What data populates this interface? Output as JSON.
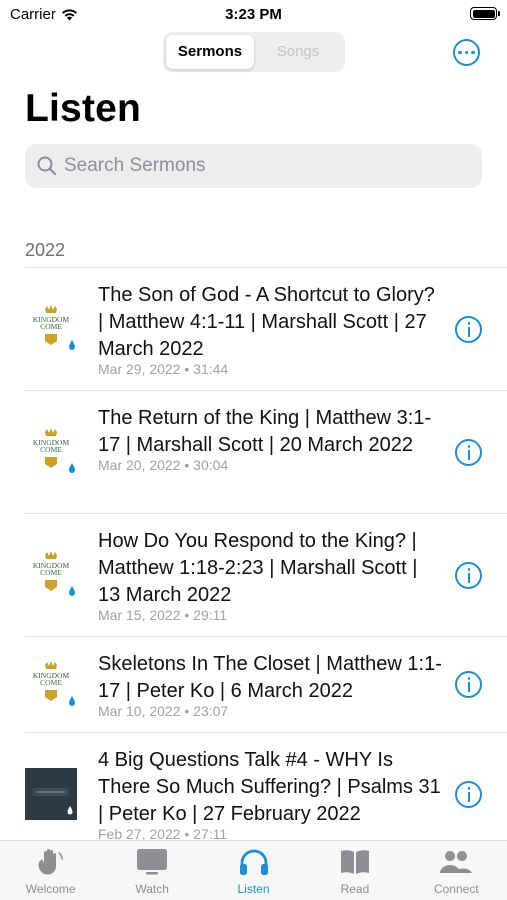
{
  "status_bar": {
    "carrier": "Carrier",
    "time": "3:23 PM"
  },
  "segments": {
    "sermons": "Sermons",
    "songs": "Songs"
  },
  "page_title": "Listen",
  "search": {
    "placeholder": "Search Sermons"
  },
  "section_header": "2022",
  "sermons": [
    {
      "title": "The Son of God - A Shortcut to Glory? | Matthew 4:1-11 | Marshall Scott | 27 March 2022",
      "meta": "Mar 29, 2022 • 31:44",
      "artwork": "kingdom-come"
    },
    {
      "title": "The Return of the King | Matthew 3:1-17 | Marshall Scott | 20 March 2022",
      "meta": "Mar 20, 2022 • 30:04",
      "artwork": "kingdom-come"
    },
    {
      "title": "How Do You Respond to the King? | Matthew 1:18-2:23 | Marshall Scott | 13 March 2022",
      "meta": "Mar 15, 2022 • 29:11",
      "artwork": "kingdom-come"
    },
    {
      "title": "Skeletons In The Closet | Matthew 1:1-17 | Peter Ko | 6 March 2022",
      "meta": "Mar 10, 2022 • 23:07",
      "artwork": "kingdom-come"
    },
    {
      "title": "4 Big Questions Talk #4 - WHY Is There So Much Suffering? | Psalms 31 | Peter Ko | 27 February 2022",
      "meta": "Feb 27, 2022 • 27:11",
      "artwork": "dark-series"
    }
  ],
  "artwork_text": {
    "line1": "KINGDOM",
    "line2": "COME"
  },
  "tabs": [
    {
      "label": "Welcome",
      "icon": "wave-hand-icon",
      "active": false
    },
    {
      "label": "Watch",
      "icon": "tv-icon",
      "active": false
    },
    {
      "label": "Listen",
      "icon": "headphones-icon",
      "active": true
    },
    {
      "label": "Read",
      "icon": "book-icon",
      "active": false
    },
    {
      "label": "Connect",
      "icon": "people-icon",
      "active": false
    }
  ],
  "colors": {
    "accent": "#1a8fd6",
    "inactive": "#8e8e93",
    "artwork_gold": "#c9a227",
    "artwork_green": "#2f6b3a"
  }
}
